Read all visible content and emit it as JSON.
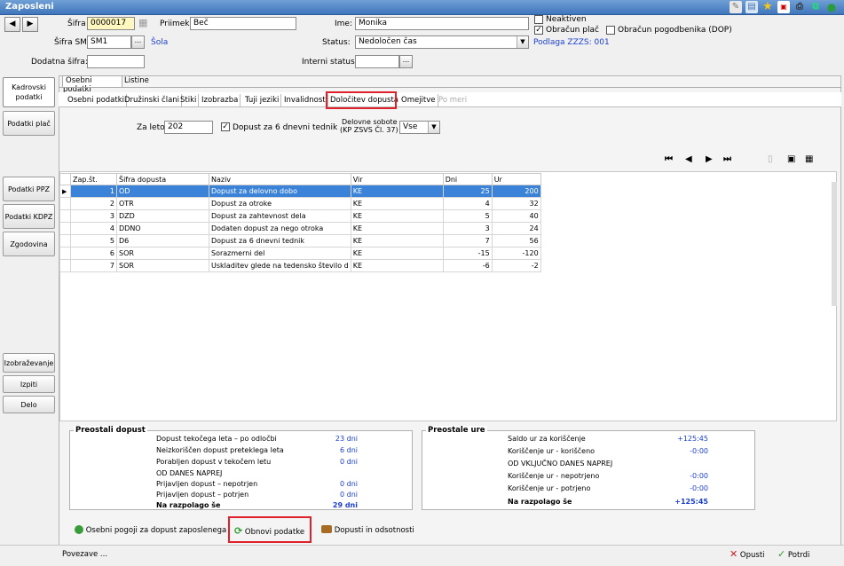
{
  "window": {
    "title": "Zaposleni"
  },
  "header": {
    "sifra_label": "Šifra",
    "sifra_value": "0000017",
    "priimek_label": "Priimek:",
    "priimek_value": "Beč",
    "ime_label": "Ime:",
    "ime_value": "Monika",
    "neaktiven_label": "Neaktiven",
    "obracun_plac_label": "Obračun plač",
    "obracun_pogodbenika_label": "Obračun pogodbenika (DOP)",
    "sifra_sm_label": "Šifra SM",
    "sifra_sm_value": "SM1",
    "sifra_sm_link": "Šola",
    "status_label": "Status:",
    "status_value": "Nedoločen čas",
    "podlaga_link": "Podlaga ZZZS: 001",
    "dodatna_sifra_label": "Dodatna šifra:",
    "dodatna_sifra_value": "",
    "interni_status_label": "Interni statusi:",
    "interni_status_value": ""
  },
  "sidebar": {
    "items": [
      {
        "label": "Kadrovski podatki"
      },
      {
        "label": "Podatki plač"
      },
      {
        "label": "Podatki PPZ"
      },
      {
        "label": "Podatki KDPZ"
      },
      {
        "label": "Zgodovina"
      },
      {
        "label": "Izobraževanje"
      },
      {
        "label": "Izpiti"
      },
      {
        "label": "Delo"
      }
    ]
  },
  "tabs_top": [
    "Osebni podatki",
    "Listine"
  ],
  "tabs_sub": [
    "Osebni podatki",
    "Družinski člani",
    "Stiki",
    "Izobrazba",
    "Tuji jeziki",
    "Invalidnost",
    "Določitev dopusta",
    "Omejitve",
    "Po meri"
  ],
  "filters": {
    "za_leto_label": "Za leto",
    "za_leto_value": "202",
    "dopust6_label": "Dopust za 6 dnevni tednik",
    "delovne_sobote_label1": "Delovne sobote",
    "delovne_sobote_label2": "(KP ZSVS Čl. 37)",
    "delovne_sobote_value": "Vse"
  },
  "table": {
    "headers": [
      "Zap.št.",
      "Šifra dopusta",
      "Naziv",
      "Vir",
      "Dni",
      "Ur"
    ],
    "rows": [
      [
        "1",
        "OD",
        "Dopust za delovno dobo",
        "KE",
        "25",
        "200"
      ],
      [
        "2",
        "OTR",
        "Dopust za otroke",
        "KE",
        "4",
        "32"
      ],
      [
        "3",
        "DZD",
        "Dopust za zahtevnost dela",
        "KE",
        "5",
        "40"
      ],
      [
        "4",
        "DDNO",
        "Dodaten dopust za nego otroka",
        "KE",
        "3",
        "24"
      ],
      [
        "5",
        "D6",
        "Dopust za 6 dnevni tednik",
        "KE",
        "7",
        "56"
      ],
      [
        "6",
        "SOR",
        "Sorazmerni del",
        "KE",
        "-15",
        "-120"
      ],
      [
        "7",
        "SOR",
        "Uskladitev glede na tedensko število d",
        "KE",
        "-6",
        "-2"
      ]
    ]
  },
  "preostali_dopust": {
    "title": "Preostali dopust",
    "rows": [
      {
        "label": "Dopust tekočega leta – po odločbi",
        "value": "23 dni"
      },
      {
        "label": "Neizkoriščen dopust preteklega leta",
        "value": "6 dni"
      },
      {
        "label": "Porabljen dopust v tekočem letu",
        "value": "0 dni"
      },
      {
        "label": "OD DANES NAPREJ",
        "value": ""
      },
      {
        "label": "Prijavljen dopust – nepotrjen",
        "value": "0 dni"
      },
      {
        "label": "Prijavljen dopust – potrjen",
        "value": "0 dni"
      },
      {
        "label": "Na razpolago še",
        "value": "29 dni"
      }
    ]
  },
  "preostale_ure": {
    "title": "Preostale ure",
    "rows": [
      {
        "label": "Saldo ur za koriščenje",
        "value": "+125:45"
      },
      {
        "label": "Koriščenje ur - koriščeno",
        "value": "-0:00"
      },
      {
        "label": "OD VKLJUČNO DANES NAPREJ",
        "value": ""
      },
      {
        "label": "Koriščenje ur - nepotrjeno",
        "value": "-0:00"
      },
      {
        "label": "Koriščenje ur - potrjeno",
        "value": "-0:00"
      },
      {
        "label": "Na razpolago še",
        "value": "+125:45"
      }
    ]
  },
  "bottom": {
    "osebni_pogoji": "Osebni pogoji za dopust zaposlenega",
    "obnovi": "Obnovi podatke",
    "dopusti_odsotnosti": "Dopusti in odsotnosti",
    "povezave": "Povezave ...",
    "opusti": "Opusti",
    "potrdi": "Potrdi"
  },
  "colors": {
    "selection": "#3b83d8",
    "highlight": "#e0202a",
    "link": "#1a3fd6",
    "titlebar": "#3f76bc"
  }
}
